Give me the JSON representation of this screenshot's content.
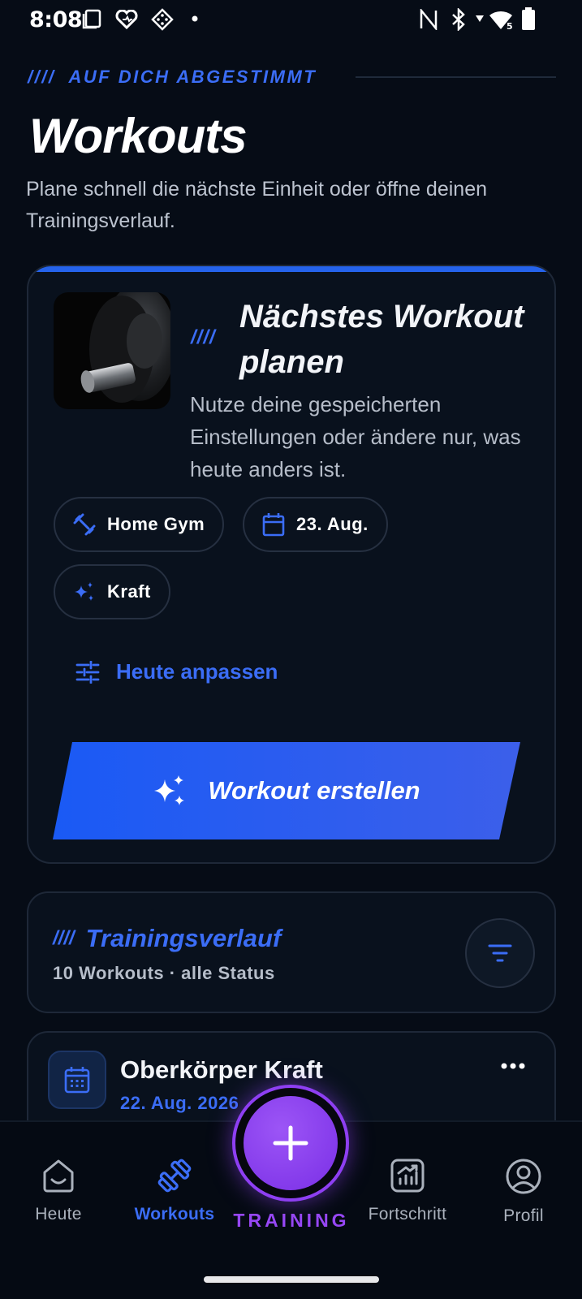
{
  "status_bar": {
    "time": "8:08"
  },
  "header": {
    "kicker_slashes": "////",
    "kicker": "AUF DICH ABGESTIMMT",
    "title": "Workouts",
    "subtitle": "Plane schnell die nächste Einheit oder öffne deinen Trainingsverlauf."
  },
  "plan_card": {
    "slashes": "////",
    "title": "Nächstes Workout planen",
    "description": "Nutze deine gespeicherten Einstellungen oder ändere nur, was heute anders ist.",
    "chips": [
      {
        "label": "Home Gym",
        "icon": "dumbbell-icon"
      },
      {
        "label": "23. Aug.",
        "icon": "calendar-icon"
      },
      {
        "label": "Kraft",
        "icon": "sparkles-icon"
      }
    ],
    "adjust_label": "Heute anpassen",
    "create_label": "Workout erstellen"
  },
  "history": {
    "slashes": "////",
    "title": "Trainingsverlauf",
    "meta": "10 Workouts · alle Status"
  },
  "workout_item": {
    "title": "Oberkörper Kraft",
    "date": "22. Aug. 2026"
  },
  "nav": {
    "items": [
      {
        "label": "Heute",
        "icon": "home-icon"
      },
      {
        "label": "Workouts",
        "icon": "dumbbell-icon"
      },
      {
        "label": "Fortschritt",
        "icon": "chart-icon"
      },
      {
        "label": "Profil",
        "icon": "profile-icon"
      }
    ],
    "fab_label": "TRAINING"
  },
  "colors": {
    "accent": "#3b6df6",
    "background": "#060c16",
    "fab": "#8e3ff2"
  }
}
